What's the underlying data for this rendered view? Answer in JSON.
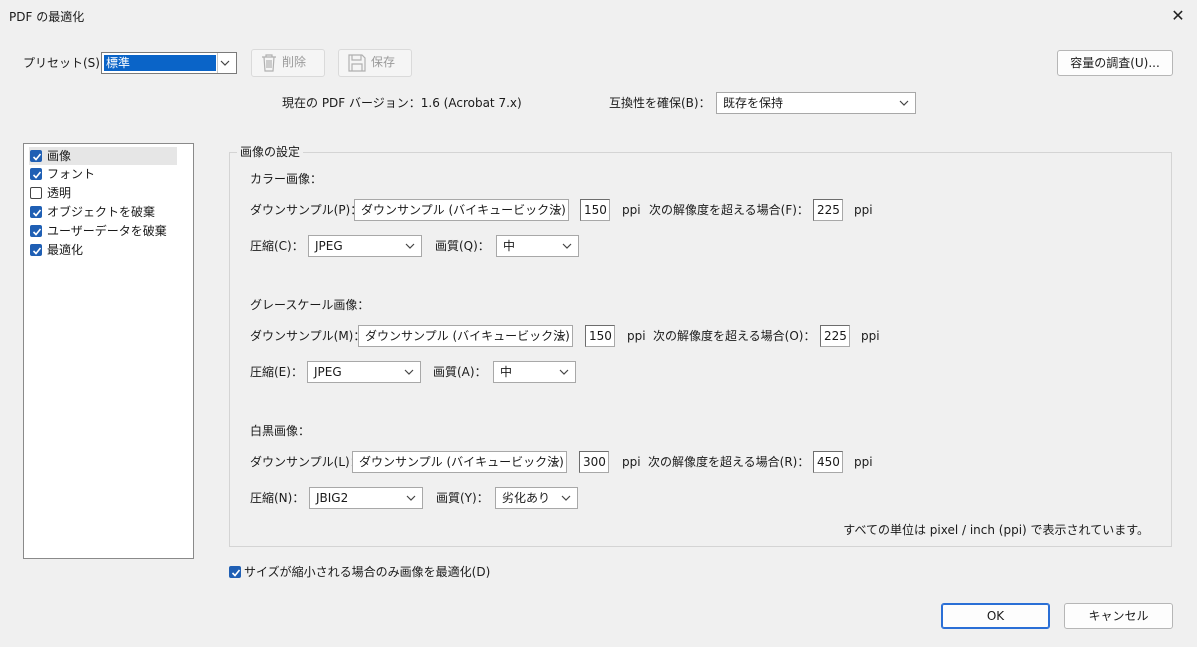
{
  "window": {
    "title": "PDF の最適化",
    "close_glyph": "✕"
  },
  "top": {
    "preset_label": "プリセット(S)：",
    "preset_value": "標準",
    "delete_label": "削除",
    "save_label": "保存",
    "capacity_label": "容量の調査(U)...",
    "version_text": "現在の PDF バージョン：1.6 (Acrobat 7.x)",
    "compat_label": "互換性を確保(B)：",
    "compat_value": "既存を保持"
  },
  "sidebar": {
    "items": [
      {
        "label": "画像",
        "checked": true
      },
      {
        "label": "フォント",
        "checked": true
      },
      {
        "label": "透明",
        "checked": false
      },
      {
        "label": "オブジェクトを破棄",
        "checked": true
      },
      {
        "label": "ユーザーデータを破棄",
        "checked": true
      },
      {
        "label": "最適化",
        "checked": true
      }
    ]
  },
  "settings": {
    "group_title": "画像の設定",
    "color": {
      "heading": "カラー画像：",
      "downsample_label": "ダウンサンプル(P)：",
      "downsample_value": "ダウンサンプル (バイキュービック法)",
      "res_value": "150",
      "ppi1": "ppi",
      "threshold_label": "次の解像度を超える場合(F)：",
      "threshold_value": "225",
      "ppi2": "ppi",
      "compress_label": "圧縮(C)：",
      "compress_value": "JPEG",
      "quality_label": "画質(Q)：",
      "quality_value": "中"
    },
    "gray": {
      "heading": "グレースケール画像：",
      "downsample_label": "ダウンサンプル(M)：",
      "downsample_value": "ダウンサンプル (バイキュービック法)",
      "res_value": "150",
      "ppi1": "ppi",
      "threshold_label": "次の解像度を超える場合(O)：",
      "threshold_value": "225",
      "ppi2": "ppi",
      "compress_label": "圧縮(E)：",
      "compress_value": "JPEG",
      "quality_label": "画質(A)：",
      "quality_value": "中"
    },
    "mono": {
      "heading": "白黒画像：",
      "downsample_label": "ダウンサンプル(L)：",
      "downsample_value": "ダウンサンプル (バイキュービック法)",
      "res_value": "300",
      "ppi1": "ppi",
      "threshold_label": "次の解像度を超える場合(R)：",
      "threshold_value": "450",
      "ppi2": "ppi",
      "compress_label": "圧縮(N)：",
      "compress_value": "JBIG2",
      "quality_label": "画質(Y)：",
      "quality_value": "劣化あり"
    },
    "units_note": "すべての単位は pixel / inch (ppi) で表示されています。"
  },
  "footer": {
    "optimize_only_label": "サイズが縮小される場合のみ画像を最適化(D)",
    "optimize_only_checked": true,
    "ok_label": "OK",
    "cancel_label": "キャンセル"
  },
  "colors": {
    "accent": "#1f5fb4",
    "selection": "#0a64c8",
    "ok_border": "#2a6fd6"
  },
  "icons": [
    "close-icon",
    "chevron-down-icon",
    "trash-icon",
    "save-icon",
    "checkmark-icon"
  ]
}
